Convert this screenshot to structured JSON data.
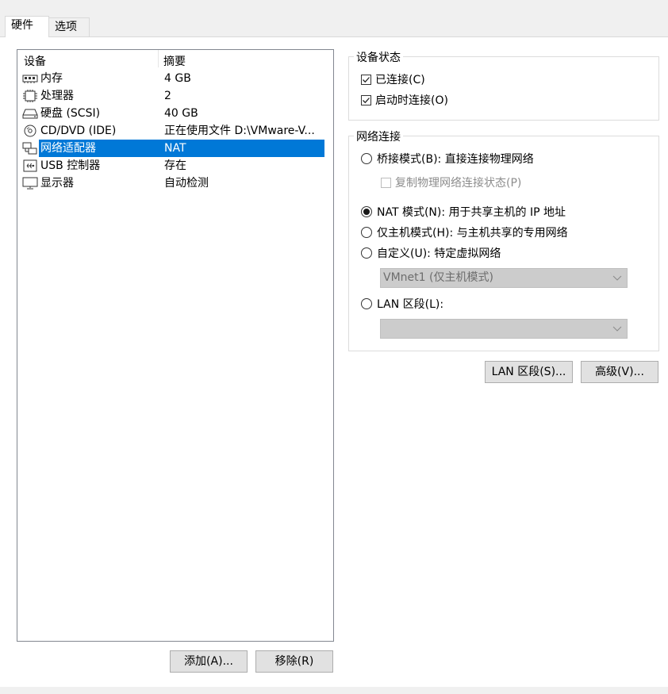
{
  "tabs": [
    {
      "label": "硬件",
      "active": true
    },
    {
      "label": "选项",
      "active": false
    }
  ],
  "device_list": {
    "headers": {
      "device": "设备",
      "summary": "摘要"
    },
    "rows": [
      {
        "name": "内存",
        "summary": "4 GB",
        "icon": "memory-icon"
      },
      {
        "name": "处理器",
        "summary": "2",
        "icon": "processor-icon"
      },
      {
        "name": "硬盘 (SCSI)",
        "summary": "40 GB",
        "icon": "harddisk-icon"
      },
      {
        "name": "CD/DVD (IDE)",
        "summary": "正在使用文件 D:\\VMware-V...",
        "icon": "cd-dvd-icon"
      },
      {
        "name": "网络适配器",
        "summary": "NAT",
        "icon": "network-adapter-icon",
        "selected": true
      },
      {
        "name": "USB 控制器",
        "summary": "存在",
        "icon": "usb-icon"
      },
      {
        "name": "显示器",
        "summary": "自动检测",
        "icon": "display-icon"
      }
    ],
    "selected_color": "#0078d7"
  },
  "buttons": {
    "add": "添加(A)...",
    "remove": "移除(R)",
    "lan_segments": "LAN 区段(S)...",
    "advanced": "高级(V)..."
  },
  "device_status": {
    "title": "设备状态",
    "connected": {
      "label": "已连接(C)",
      "checked": true
    },
    "connect_at_power_on": {
      "label": "启动时连接(O)",
      "checked": true
    }
  },
  "network_connection": {
    "title": "网络连接",
    "bridged": {
      "label": "桥接模式(B): 直接连接物理网络",
      "selected": false
    },
    "replicate": {
      "label": "复制物理网络连接状态(P)",
      "checked": false,
      "disabled": true
    },
    "nat": {
      "label": "NAT 模式(N): 用于共享主机的 IP 地址",
      "selected": true
    },
    "host_only": {
      "label": "仅主机模式(H): 与主机共享的专用网络",
      "selected": false
    },
    "custom": {
      "label": "自定义(U): 特定虚拟网络",
      "selected": false
    },
    "custom_select_value": "VMnet1 (仅主机模式)",
    "lan_segment": {
      "label": "LAN 区段(L):",
      "selected": false
    },
    "lan_select_value": ""
  }
}
